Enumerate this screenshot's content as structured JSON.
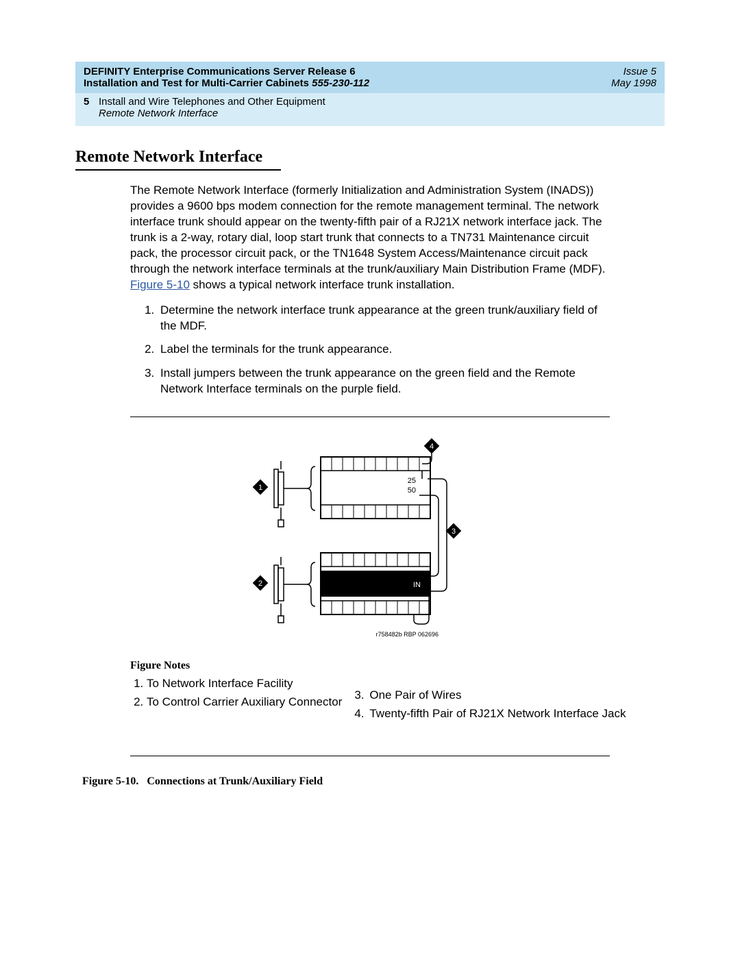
{
  "header": {
    "title_line1": "DEFINITY Enterprise Communications Server Release 6",
    "title_line2_a": "Installation and Test for Multi-Carrier Cabinets ",
    "title_line2_b": "555-230-112",
    "issue": "Issue 5",
    "date": "May 1998"
  },
  "subheader": {
    "chapter": "5",
    "line1": "Install and Wire Telephones and Other Equipment",
    "line2": "Remote Network Interface"
  },
  "section_title": "Remote Network Interface",
  "paragraph_a": "The Remote Network Interface (formerly Initialization and Administration System (INADS)) provides a 9600 bps modem connection for the remote management terminal. The network interface trunk should appear on the twenty-fifth pair of a RJ21X network interface jack. The trunk is a 2-way, rotary dial, loop start trunk that connects to a TN731 Maintenance circuit pack, the processor circuit pack, or the TN1648 System Access/Maintenance circuit pack through the network interface terminals at the trunk/auxiliary Main Distribution Frame (MDF). ",
  "fig_link_a": "Figure ",
  "fig_link_b": "5-10",
  "paragraph_b": " shows a typical network interface trunk installation.",
  "steps": [
    "Determine the network interface trunk appearance at the green trunk/auxiliary field of the MDF.",
    "Label the terminals for the trunk appearance.",
    "Install jumpers between the trunk appearance on the green field and the Remote Network Interface terminals on the purple field."
  ],
  "figure": {
    "callouts": {
      "c1": "1",
      "c2": "2",
      "c3": "3",
      "c4": "4"
    },
    "labels": {
      "n25": "25",
      "n50": "50",
      "in": "IN"
    },
    "footer": "r758482b RBP 062696"
  },
  "figure_notes_title": "Figure Notes",
  "figure_notes": {
    "l1": "To Network Interface Facility",
    "l2": "To Control Carrier Auxiliary Connector",
    "r3": "One Pair of Wires",
    "r4": "Twenty-fifth Pair of RJ21X Network Interface Jack",
    "n3": "3.",
    "n4": "4."
  },
  "caption": {
    "fignum": "Figure 5-10.",
    "text": "Connections at Trunk/Auxiliary Field"
  }
}
